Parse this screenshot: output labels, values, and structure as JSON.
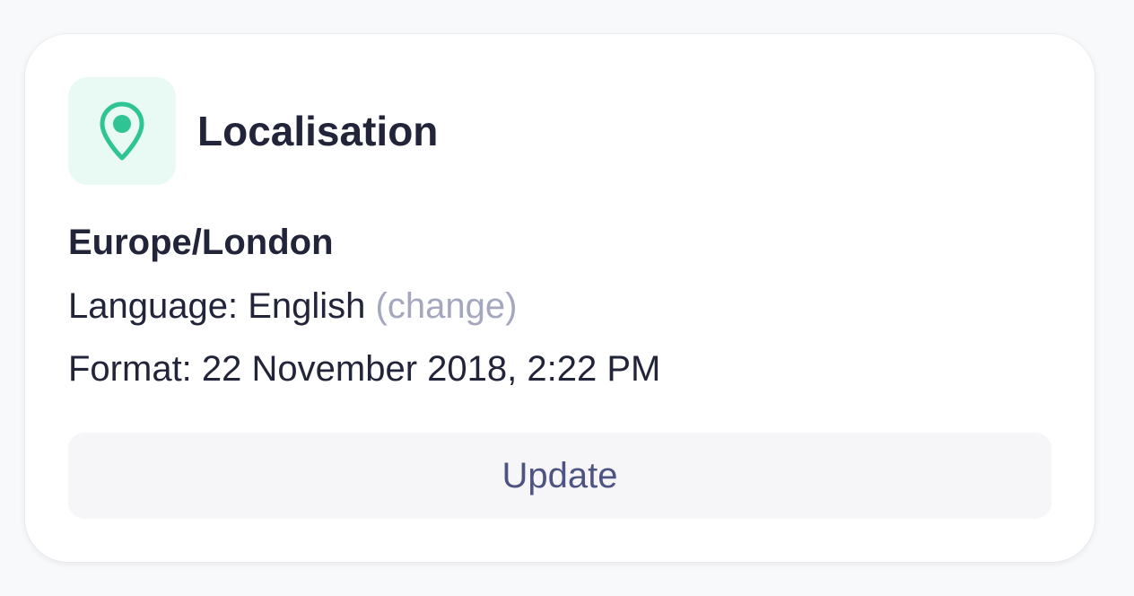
{
  "card": {
    "title": "Localisation",
    "icon": "map-pin-icon",
    "accent_color": "#2fc493",
    "icon_tile_color": "#e8faf3"
  },
  "timezone": "Europe/London",
  "language": {
    "label": "Language:",
    "value": "English",
    "change_link": "(change)"
  },
  "format": {
    "label": "Format:",
    "value": "22 November 2018, 2:22 PM"
  },
  "actions": {
    "update_label": "Update"
  }
}
